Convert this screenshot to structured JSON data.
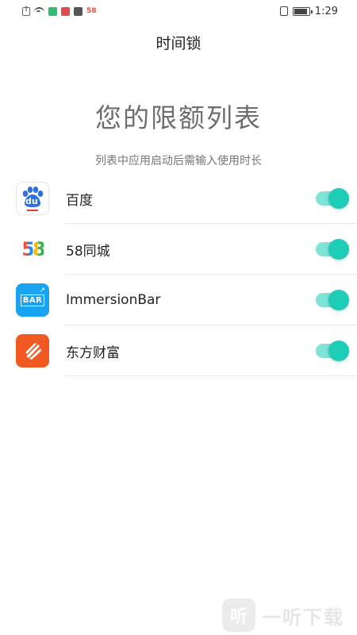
{
  "status_bar": {
    "time": "1:29",
    "left_icons": [
      "alert-icon",
      "wifi-icon",
      "app-notification-icon",
      "app-notification-icon",
      "app-notification-icon",
      "58-notification-icon"
    ],
    "notification_58": "58",
    "right_icons": [
      "vibrate-icon",
      "battery-icon"
    ],
    "battery_level": 0.9
  },
  "page": {
    "title": "时间锁"
  },
  "heading": {
    "title": "您的限额列表",
    "subtitle": "列表中应用启动后需输入使用时长"
  },
  "apps": [
    {
      "name": "百度",
      "icon": "baidu-app-icon",
      "enabled": true,
      "icon_text": "du"
    },
    {
      "name": "58同城",
      "icon": "58-app-icon",
      "enabled": true,
      "icon_text": "58"
    },
    {
      "name": "ImmersionBar",
      "icon": "immersionbar-app-icon",
      "enabled": true,
      "icon_text": "BAR"
    },
    {
      "name": "东方财富",
      "icon": "eastmoney-app-icon",
      "enabled": true
    }
  ],
  "colors": {
    "toggle_on_track": "#7fe3d6",
    "toggle_on_knob": "#1ecdb8",
    "heading_gray": "#6e6e6e"
  },
  "watermark": {
    "badge": "听",
    "text": "一听下载"
  }
}
